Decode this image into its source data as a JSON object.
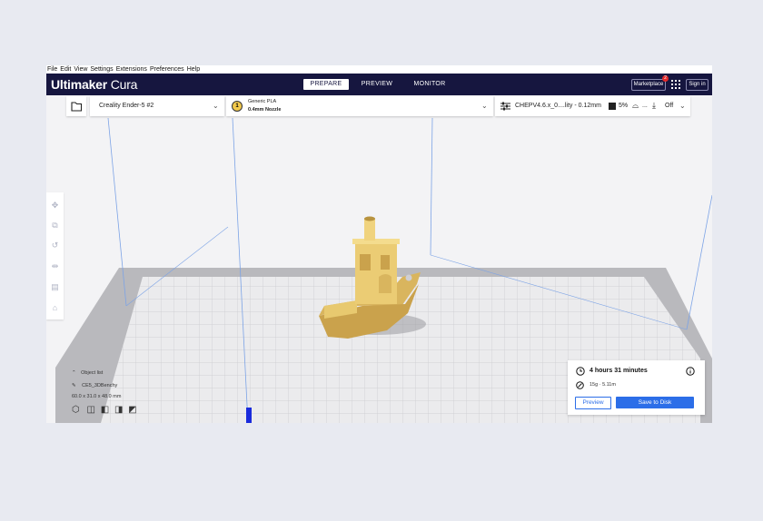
{
  "menu": [
    "File",
    "Edit",
    "View",
    "Settings",
    "Extensions",
    "Preferences",
    "Help"
  ],
  "header": {
    "brand_bold": "Ultimaker",
    "brand_light": "Cura",
    "stages": [
      "PREPARE",
      "PREVIEW",
      "MONITOR"
    ],
    "active_stage": "PREPARE",
    "marketplace_label": "Marketplace",
    "marketplace_badge": "2",
    "signin_label": "Sign in"
  },
  "toolbar": {
    "printer": "Creality Ender-5 #2",
    "extruder_number": "1",
    "material": "Generic PLA",
    "nozzle": "0.4mm Nozzle",
    "profile": "CHEPV4.6.x_0....lity - 0.12mm",
    "infill": "5%",
    "support_value": "...",
    "adhesion": "Off"
  },
  "object_list": {
    "header": "Object list",
    "object_name": "CE5_3DBenchy",
    "dimensions": "60.0 x 31.0 x 48.0 mm"
  },
  "job": {
    "time": "4 hours 31 minutes",
    "material_usage": "15g · 5.11m",
    "preview_label": "Preview",
    "save_label": "Save to Disk"
  },
  "colors": {
    "header_bg": "#16163f",
    "accent_blue": "#2c6ee8",
    "model_yellow": "#f2d27a",
    "badge_red": "#e32a2a"
  }
}
